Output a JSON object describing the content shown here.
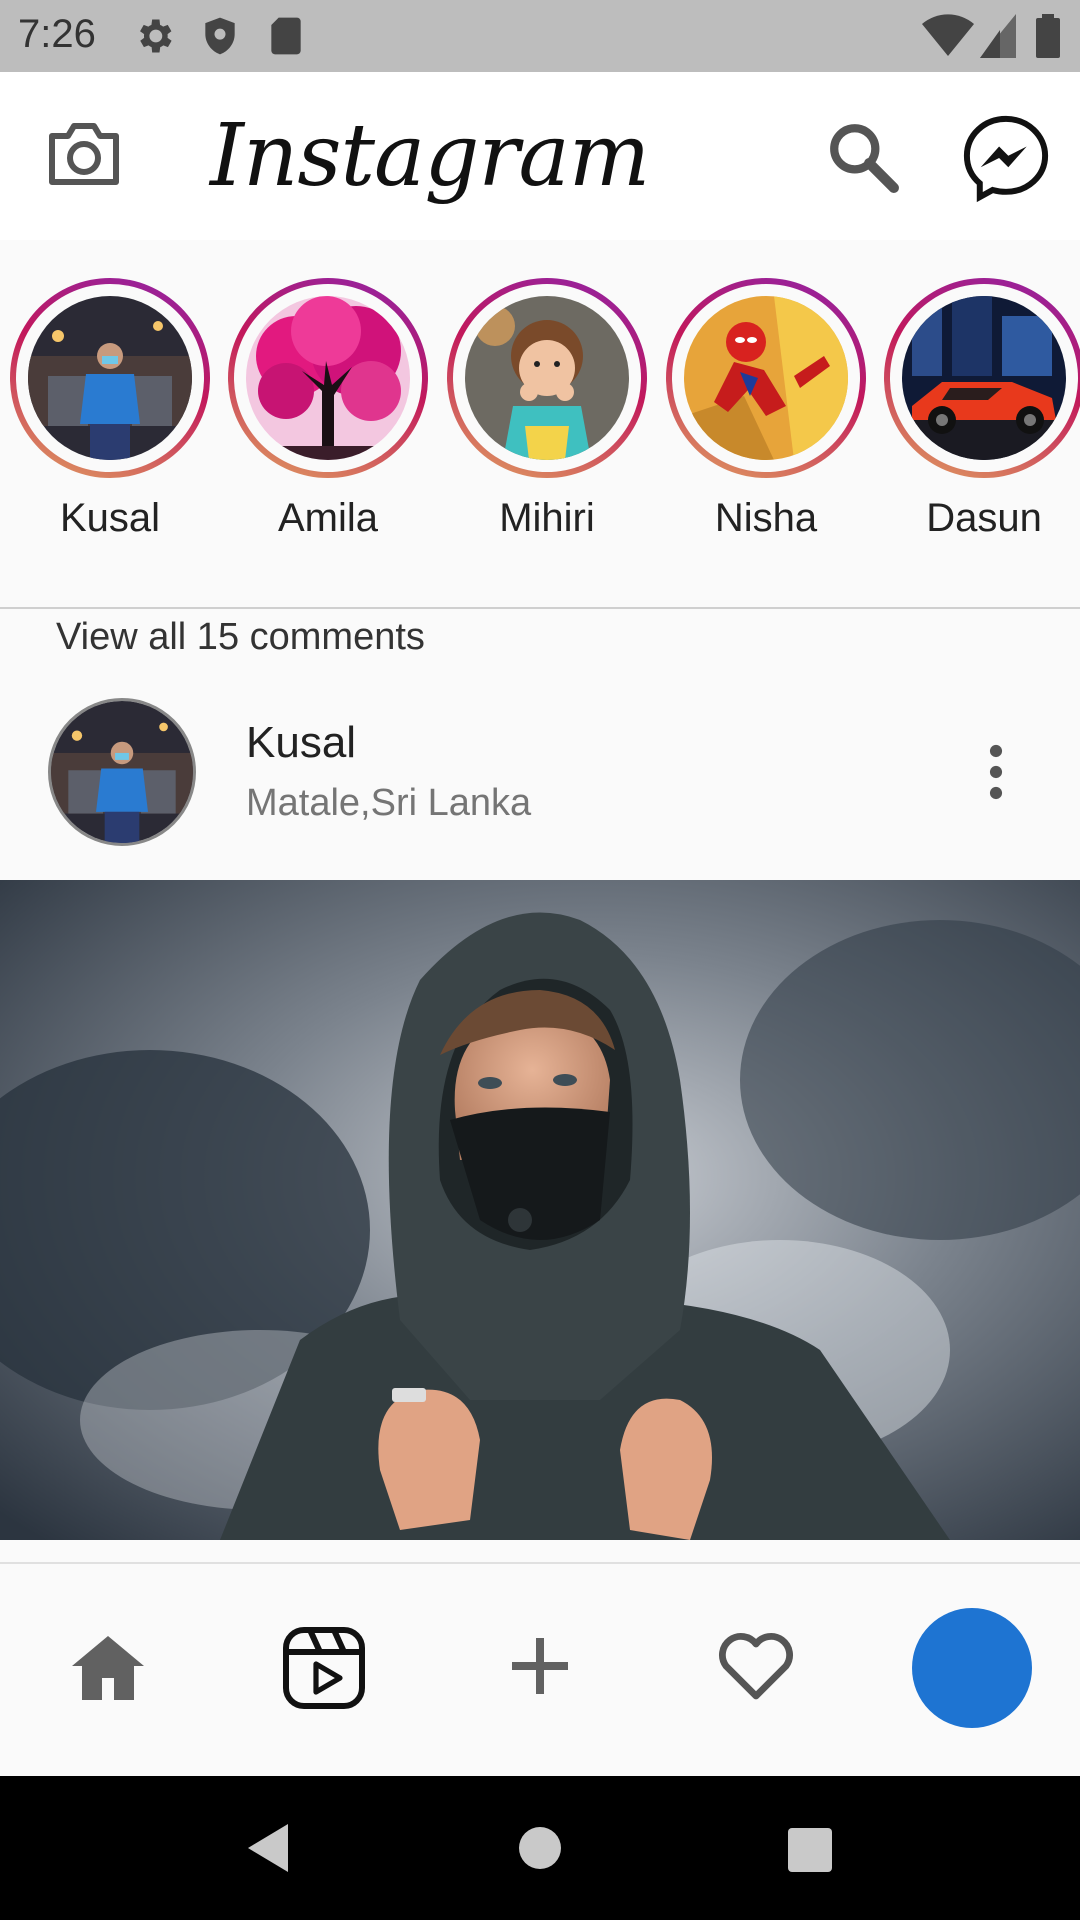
{
  "status_bar": {
    "time": "7:26",
    "icons": [
      "gear-icon",
      "shield-icon",
      "sd-card-icon",
      "wifi-icon",
      "signal-icon",
      "battery-icon"
    ]
  },
  "app_bar": {
    "logo_text": "Instagram",
    "icons": [
      "camera-icon",
      "search-icon",
      "messenger-icon"
    ]
  },
  "stories": [
    {
      "name": "Kusal"
    },
    {
      "name": "Amila"
    },
    {
      "name": "Mihiri"
    },
    {
      "name": "Nisha"
    },
    {
      "name": "Dasun"
    }
  ],
  "post": {
    "comments_link": "View all 15 comments",
    "username": "Kusal",
    "location": "Matale,Sri Lanka"
  },
  "bottom_nav": {
    "items": [
      "home-icon",
      "reels-icon",
      "add-icon",
      "heart-icon",
      "profile-avatar"
    ],
    "profile_color": "#1e74d2"
  },
  "system_nav": {
    "items": [
      "back-icon",
      "home-circle-icon",
      "recents-icon"
    ]
  }
}
